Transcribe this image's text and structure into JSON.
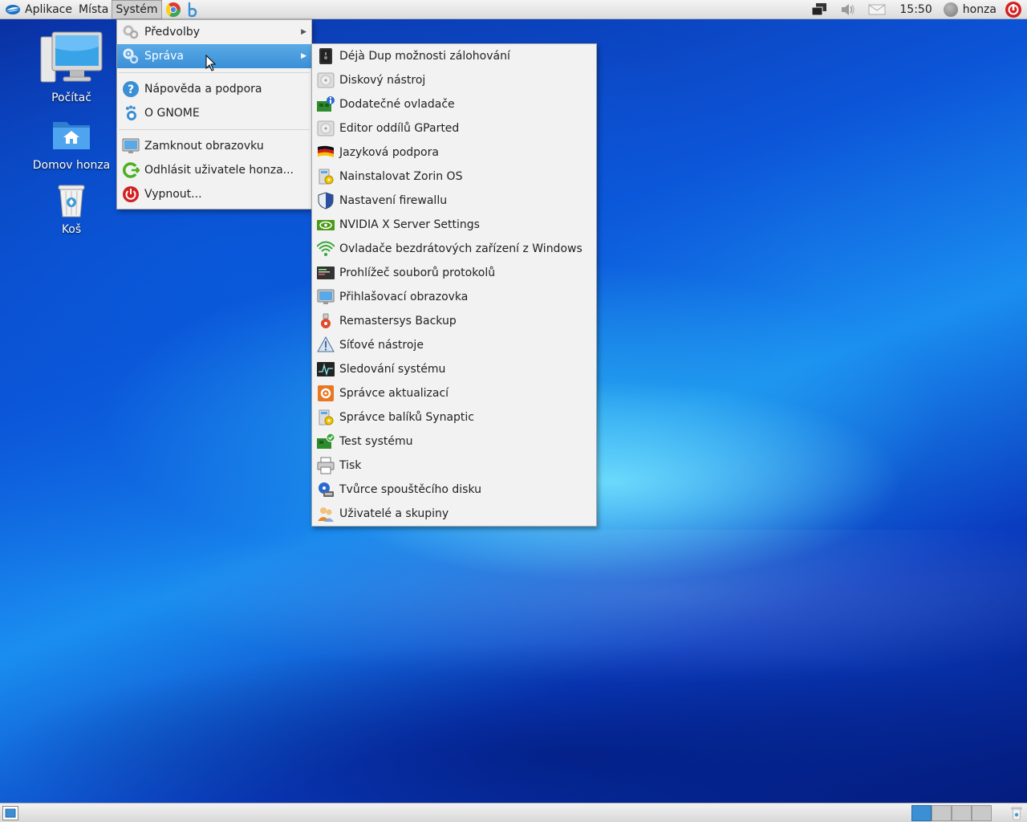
{
  "top_panel": {
    "menus": [
      "Aplikace",
      "Místa",
      "Systém"
    ],
    "clock": "15:50",
    "user": "honza"
  },
  "desktop_icons": [
    {
      "label": "Počítač",
      "icon": "computer-icon"
    },
    {
      "label": "Domov honza",
      "icon": "home-folder-icon"
    },
    {
      "label": "Koš",
      "icon": "trash-icon"
    }
  ],
  "system_menu": {
    "items": [
      {
        "label": "Předvolby",
        "icon": "preferences-icon",
        "submenu": true
      },
      {
        "label": "Správa",
        "icon": "administration-icon",
        "submenu": true,
        "selected": true
      },
      {
        "label": "Nápověda a podpora",
        "icon": "help-icon"
      },
      {
        "label": "O GNOME",
        "icon": "gnome-icon"
      },
      {
        "label": "Zamknout obrazovku",
        "icon": "lock-screen-icon"
      },
      {
        "label": "Odhlásit uživatele honza...",
        "icon": "logout-icon"
      },
      {
        "label": "Vypnout...",
        "icon": "shutdown-icon"
      }
    ]
  },
  "admin_menu": {
    "items": [
      {
        "label": "Déjà Dup možnosti zálohování",
        "icon": "backup-icon"
      },
      {
        "label": "Diskový nástroj",
        "icon": "disk-utility-icon"
      },
      {
        "label": "Dodatečné ovladače",
        "icon": "drivers-icon"
      },
      {
        "label": "Editor oddílů GParted",
        "icon": "gparted-icon"
      },
      {
        "label": "Jazyková podpora",
        "icon": "language-flag-icon"
      },
      {
        "label": "Nainstalovat Zorin OS",
        "icon": "installer-icon"
      },
      {
        "label": "Nastavení firewallu",
        "icon": "firewall-shield-icon"
      },
      {
        "label": "NVIDIA X Server Settings",
        "icon": "nvidia-icon"
      },
      {
        "label": "Ovladače bezdrátových zařízení z Windows",
        "icon": "wireless-icon"
      },
      {
        "label": "Prohlížeč souborů protokolů",
        "icon": "log-viewer-icon"
      },
      {
        "label": "Přihlašovací obrazovka",
        "icon": "login-screen-icon"
      },
      {
        "label": "Remastersys Backup",
        "icon": "remastersys-icon"
      },
      {
        "label": "Síťové nástroje",
        "icon": "network-tools-icon"
      },
      {
        "label": "Sledování systému",
        "icon": "system-monitor-icon"
      },
      {
        "label": "Správce aktualizací",
        "icon": "update-manager-icon"
      },
      {
        "label": "Správce balíků Synaptic",
        "icon": "synaptic-icon"
      },
      {
        "label": "Test systému",
        "icon": "system-test-icon"
      },
      {
        "label": "Tisk",
        "icon": "printer-icon"
      },
      {
        "label": "Tvůrce spouštěcího disku",
        "icon": "startup-disk-icon"
      },
      {
        "label": "Uživatelé a skupiny",
        "icon": "users-groups-icon"
      }
    ]
  },
  "colors": {
    "selection": "#3a8fd6",
    "menu_bg": "#f2f2f2",
    "shutdown_red": "#d42020"
  }
}
